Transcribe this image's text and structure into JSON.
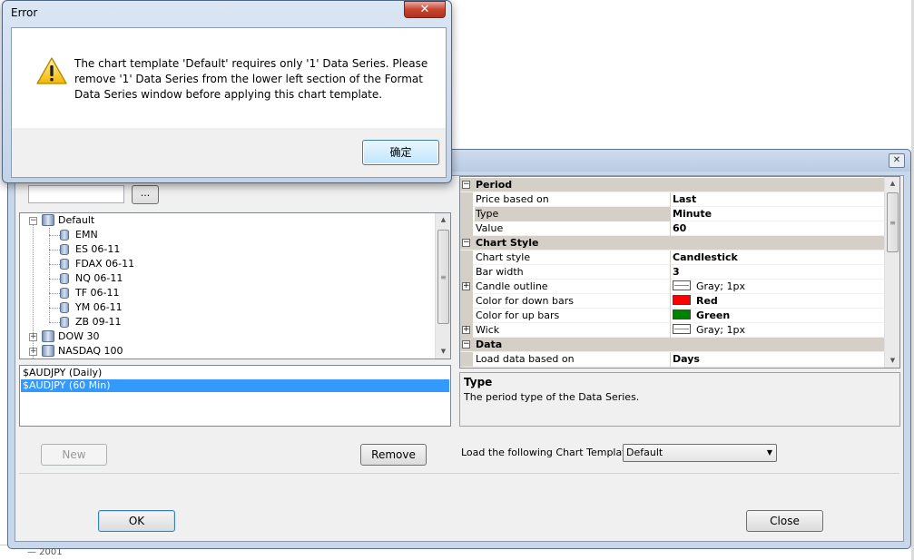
{
  "error_dialog": {
    "title": "Error",
    "close_label": "✕",
    "message": "The chart template 'Default' requires only '1' Data Series. Please remove '1' Data Series from the lower left section of the Format Data Series window before applying this chart template.",
    "ok_label": "确定"
  },
  "main_window": {
    "close_label": "✕",
    "search": {
      "value": "",
      "placeholder": ""
    },
    "browse_label": "...",
    "tree": {
      "root": "Default",
      "children": [
        "EMN",
        "ES 06-11",
        "FDAX 06-11",
        "NQ 06-11",
        "TF 06-11",
        "YM 06-11",
        "ZB 09-11"
      ],
      "siblings": [
        "DOW 30",
        "NASDAQ 100"
      ]
    },
    "series": [
      {
        "label": "$AUDJPY (Daily)",
        "selected": false
      },
      {
        "label": "$AUDJPY (60 Min)",
        "selected": true
      }
    ],
    "new_label": "New",
    "remove_label": "Remove",
    "ok_label": "OK",
    "close_label_btn": "Close",
    "template_label": "Load the following Chart Template:",
    "template_value": "Default"
  },
  "properties": {
    "categories": [
      {
        "name": "Period",
        "rows": [
          {
            "name": "Price based on",
            "value": "Last"
          },
          {
            "name": "Type",
            "value": "Minute"
          },
          {
            "name": "Value",
            "value": "60"
          }
        ]
      },
      {
        "name": "Chart Style",
        "rows": [
          {
            "name": "Chart style",
            "value": "Candlestick"
          },
          {
            "name": "Bar width",
            "value": "3"
          },
          {
            "name": "Candle outline",
            "value": "Gray; 1px"
          },
          {
            "name": "Color for down bars",
            "value": "Red",
            "color": "#ff0000"
          },
          {
            "name": "Color for up bars",
            "value": "Green",
            "color": "#008000"
          },
          {
            "name": "Wick",
            "value": "Gray; 1px"
          }
        ]
      },
      {
        "name": "Data",
        "rows": [
          {
            "name": "Load data based on",
            "value": "Days"
          }
        ]
      }
    ],
    "description": {
      "title": "Type",
      "text": "The period type of the Data Series."
    }
  },
  "background": {
    "partial_text": "— 2001"
  }
}
